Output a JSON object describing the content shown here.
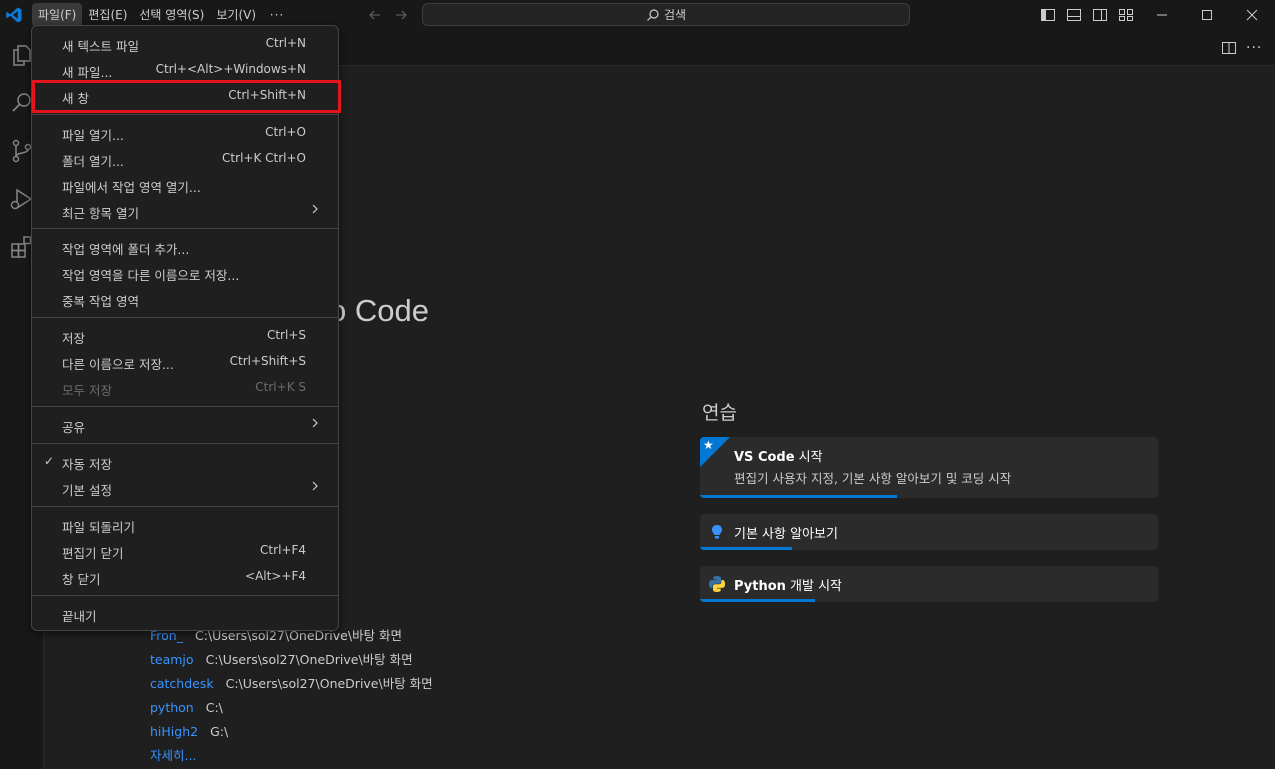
{
  "menubar": {
    "items": [
      "파일(F)",
      "편집(E)",
      "선택 영역(S)",
      "보기(V)"
    ],
    "more": "···"
  },
  "search": {
    "label": "검색"
  },
  "welcome": {
    "title_fragment": "o Code",
    "walkthroughs_heading": "연습",
    "cards": [
      {
        "title_bold": "VS Code",
        "title_rest": " 시작",
        "description": "편집기 사용자 지정, 기본 사항 알아보기 및 코딩 시작",
        "progress": 0.43
      },
      {
        "title_bold": "",
        "title_rest": "기본 사항 알아보기",
        "description": "",
        "progress": 0.2
      },
      {
        "title_bold": "Python",
        "title_rest": " 개발 시작",
        "description": "",
        "progress": 0.25
      }
    ],
    "recent": [
      {
        "name": "Fron_",
        "path": "C:\\Users\\sol27\\OneDrive\\바탕 화면"
      },
      {
        "name": "teamjo",
        "path": "C:\\Users\\sol27\\OneDrive\\바탕 화면"
      },
      {
        "name": "catchdesk",
        "path": "C:\\Users\\sol27\\OneDrive\\바탕 화면"
      },
      {
        "name": "python",
        "path": "C:\\"
      },
      {
        "name": "hiHigh2",
        "path": "G:\\"
      }
    ],
    "more_label": "자세히..."
  },
  "file_menu": {
    "items": [
      {
        "label": "새 텍스트 파일",
        "shortcut": "Ctrl+N"
      },
      {
        "label": "새 파일...",
        "shortcut": "Ctrl+<Alt>+Windows+N"
      },
      {
        "label": "새 창",
        "shortcut": "Ctrl+Shift+N"
      },
      {
        "label": "파일 열기...",
        "shortcut": "Ctrl+O"
      },
      {
        "label": "폴더 열기...",
        "shortcut": "Ctrl+K Ctrl+O"
      },
      {
        "label": "파일에서 작업 영역 열기...",
        "shortcut": ""
      },
      {
        "label": "최근 항목 열기",
        "shortcut": ""
      },
      {
        "label": "작업 영역에 폴더 추가...",
        "shortcut": ""
      },
      {
        "label": "작업 영역을 다른 이름으로 저장...",
        "shortcut": ""
      },
      {
        "label": "중복 작업 영역",
        "shortcut": ""
      },
      {
        "label": "저장",
        "shortcut": "Ctrl+S"
      },
      {
        "label": "다른 이름으로 저장...",
        "shortcut": "Ctrl+Shift+S"
      },
      {
        "label": "모두 저장",
        "shortcut": "Ctrl+K S"
      },
      {
        "label": "공유",
        "shortcut": ""
      },
      {
        "label": "자동 저장",
        "shortcut": ""
      },
      {
        "label": "기본 설정",
        "shortcut": ""
      },
      {
        "label": "파일 되돌리기",
        "shortcut": ""
      },
      {
        "label": "편집기 닫기",
        "shortcut": "Ctrl+F4"
      },
      {
        "label": "창 닫기",
        "shortcut": "<Alt>+F4"
      },
      {
        "label": "끝내기",
        "shortcut": ""
      }
    ],
    "auto_save_checked": true
  },
  "colors": {
    "accent": "#0078d4",
    "highlight": "#e3141b",
    "link": "#3794ff"
  }
}
